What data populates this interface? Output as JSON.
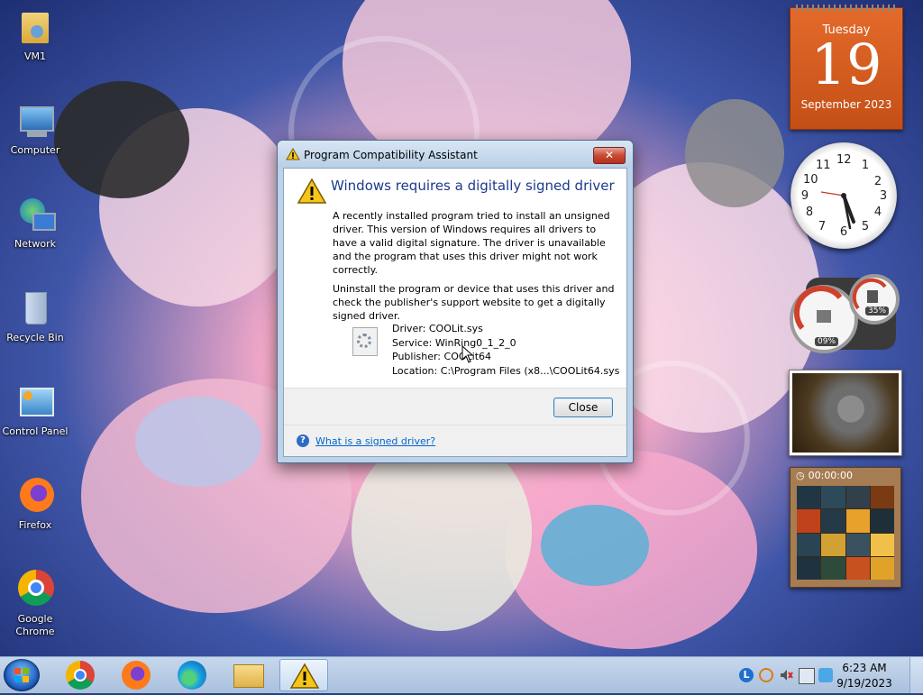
{
  "desktop": {
    "icons": [
      {
        "label": "VM1",
        "icon": "user-folder-icon"
      },
      {
        "label": "Computer",
        "icon": "computer-icon"
      },
      {
        "label": "Network",
        "icon": "network-icon"
      },
      {
        "label": "Recycle Bin",
        "icon": "recycle-bin-icon"
      },
      {
        "label": "Control Panel",
        "icon": "control-panel-icon"
      },
      {
        "label": "Firefox",
        "icon": "firefox-icon"
      },
      {
        "label": "Google Chrome",
        "icon": "chrome-icon"
      }
    ]
  },
  "gadgets": {
    "calendar": {
      "weekday": "Tuesday",
      "day": "19",
      "month_year": "September 2023"
    },
    "clock": {
      "numbers": [
        "12",
        "1",
        "2",
        "3",
        "4",
        "5",
        "6",
        "7",
        "8",
        "9",
        "10",
        "11"
      ]
    },
    "cpu_meter": {
      "cpu": "09%",
      "memory": "35%"
    },
    "puzzle": {
      "timer": "00:00:00"
    }
  },
  "dialog": {
    "title": "Program Compatibility Assistant",
    "close_glyph": "✕",
    "headline": "Windows requires a digitally signed driver",
    "paragraph1": "A recently installed program tried to install an unsigned driver. This version of Windows requires all drivers to have a valid digital signature. The driver is unavailable and the program that uses this driver might not work correctly.",
    "paragraph2": "Uninstall the program or device that uses this driver and check the publisher's support website to get a digitally signed driver.",
    "details": {
      "driver": "Driver: COOLit.sys",
      "service": "Service: WinRing0_1_2_0",
      "publisher": "Publisher: COOLit64",
      "location": "Location: C:\\Program Files (x8...\\COOLit64.sys"
    },
    "close_button": "Close",
    "help_link": "What is a signed driver?",
    "help_glyph": "?"
  },
  "taskbar": {
    "pinned": [
      "chrome-icon",
      "firefox-icon",
      "edge-icon",
      "file-explorer-icon",
      "warning-icon"
    ],
    "clock_time": "6:23 AM",
    "clock_date": "9/19/2023"
  }
}
